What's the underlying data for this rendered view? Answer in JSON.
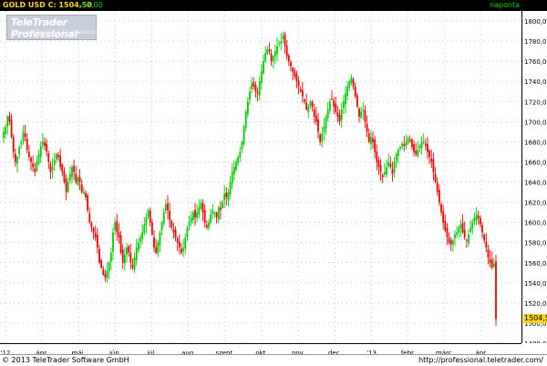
{
  "header": {
    "symbol": "GOLD USD C: 1504,50",
    "change": "-55,00",
    "period": "naponta"
  },
  "logo": {
    "title": "TeleTrader Professional",
    "url": "http://professional.teletrader.com"
  },
  "footer": {
    "copyright": "© 2013 TeleTrader Software GmbH",
    "url": "http://professional.teletrader.com/"
  },
  "colors": {
    "up": "#00cc00",
    "down": "#ee0000",
    "last_price_bg": "#ffd400",
    "grid": "#b0b0b0"
  },
  "chart_data": {
    "type": "candlestick",
    "ylim": [
      1480,
      1810
    ],
    "yticks": [
      "1800,00",
      "1780,00",
      "1760,00",
      "1740,00",
      "1720,00",
      "1700,00",
      "1680,00",
      "1660,00",
      "1640,00",
      "1620,00",
      "1600,00",
      "1580,00",
      "1560,00",
      "1540,00",
      "1520,00",
      "1500,00",
      "1480,00"
    ],
    "last_price": "1504,50",
    "xlabels": [
      "'12",
      "ápr.",
      "máj.",
      "jún.",
      "júl.",
      "aug.",
      "szept.",
      "okt.",
      "nov.",
      "dec.",
      "'13",
      "febr.",
      "márc.",
      "ápr."
    ],
    "series_close": [
      1690,
      1695,
      1705,
      1700,
      1685,
      1670,
      1660,
      1665,
      1675,
      1680,
      1690,
      1685,
      1672,
      1665,
      1660,
      1655,
      1650,
      1660,
      1668,
      1676,
      1680,
      1676,
      1670,
      1660,
      1650,
      1655,
      1662,
      1668,
      1665,
      1655,
      1650,
      1640,
      1630,
      1640,
      1648,
      1655,
      1650,
      1640,
      1645,
      1640,
      1630,
      1630,
      1625,
      1612,
      1600,
      1595,
      1590,
      1585,
      1575,
      1560,
      1555,
      1548,
      1545,
      1552,
      1560,
      1570,
      1590,
      1600,
      1590,
      1585,
      1570,
      1560,
      1568,
      1575,
      1570,
      1560,
      1555,
      1565,
      1575,
      1580,
      1585,
      1590,
      1598,
      1605,
      1612,
      1600,
      1588,
      1575,
      1570,
      1580,
      1590,
      1600,
      1610,
      1618,
      1612,
      1602,
      1595,
      1590,
      1585,
      1580,
      1575,
      1570,
      1575,
      1585,
      1595,
      1600,
      1605,
      1610,
      1605,
      1610,
      1615,
      1620,
      1610,
      1600,
      1595,
      1600,
      1608,
      1612,
      1610,
      1605,
      1615,
      1612,
      1620,
      1628,
      1625,
      1630,
      1640,
      1650,
      1655,
      1660,
      1665,
      1670,
      1680,
      1695,
      1710,
      1720,
      1730,
      1738,
      1735,
      1730,
      1728,
      1740,
      1750,
      1760,
      1768,
      1772,
      1770,
      1760,
      1765,
      1770,
      1775,
      1778,
      1780,
      1785,
      1775,
      1765,
      1760,
      1755,
      1750,
      1745,
      1740,
      1735,
      1730,
      1725,
      1720,
      1712,
      1715,
      1720,
      1715,
      1705,
      1700,
      1690,
      1680,
      1688,
      1695,
      1705,
      1712,
      1720,
      1722,
      1715,
      1710,
      1705,
      1700,
      1712,
      1720,
      1728,
      1735,
      1740,
      1744,
      1735,
      1725,
      1715,
      1705,
      1710,
      1712,
      1700,
      1690,
      1680,
      1685,
      1680,
      1670,
      1660,
      1655,
      1650,
      1645,
      1650,
      1655,
      1660,
      1655,
      1648,
      1660,
      1668,
      1672,
      1675,
      1678,
      1676,
      1680,
      1684,
      1682,
      1675,
      1670,
      1668,
      1672,
      1676,
      1680,
      1680,
      1676,
      1670,
      1665,
      1660,
      1650,
      1640,
      1630,
      1620,
      1610,
      1600,
      1592,
      1585,
      1580,
      1578,
      1582,
      1588,
      1590,
      1595,
      1598,
      1590,
      1585,
      1582,
      1588,
      1595,
      1600,
      1605,
      1608,
      1604,
      1598,
      1590,
      1582,
      1575,
      1565,
      1560,
      1555,
      1559,
      1504
    ]
  }
}
